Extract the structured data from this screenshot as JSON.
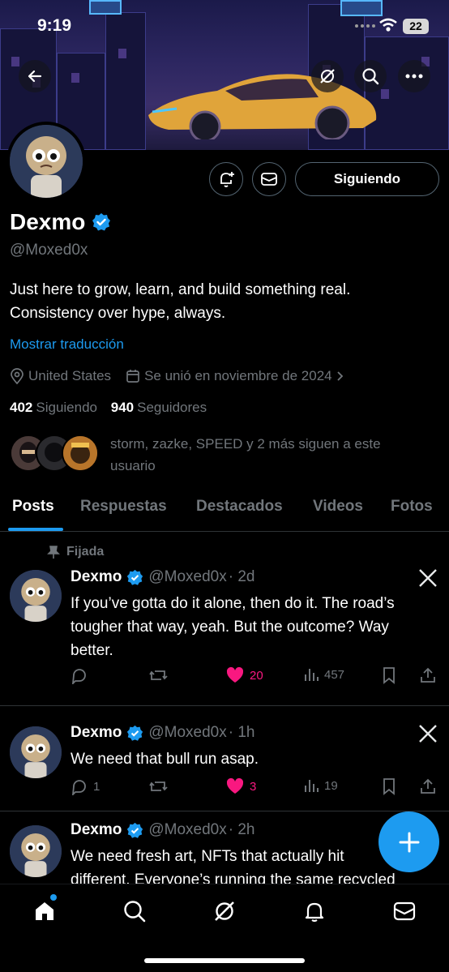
{
  "status_bar": {
    "time": "9:19",
    "battery": "22"
  },
  "profile": {
    "name": "Dexmo",
    "handle": "@Moxed0x",
    "bio_line1": "Just here to grow, learn, and build something real.",
    "bio_line2": "Consistency over hype, always.",
    "translate_label": "Mostrar traducción",
    "location": "United States",
    "joined": "Se unió en noviembre de 2024",
    "following_count": "402",
    "following_label": "Siguiendo",
    "followers_count": "940",
    "followers_label": "Seguidores",
    "followed_by_line1": "storm, zazke, SPEED y 2 más siguen a este",
    "followed_by_line2": "usuario",
    "following_button": "Siguiendo"
  },
  "tabs": [
    {
      "label": "Posts",
      "active": true
    },
    {
      "label": "Respuestas"
    },
    {
      "label": "Destacados"
    },
    {
      "label": "Videos"
    },
    {
      "label": "Fotos"
    }
  ],
  "pinned_label": "Fijada",
  "posts": [
    {
      "name": "Dexmo",
      "handle": "@Moxed0x",
      "time": "· 2d",
      "text_lines": [
        "If you’ve gotta do it alone, then do it. The road’s",
        "tougher that way, yeah. But the outcome? Way",
        "better."
      ],
      "replies": "",
      "reposts": "",
      "likes": "20",
      "views": "457"
    },
    {
      "name": "Dexmo",
      "handle": "@Moxed0x",
      "time": "· 1h",
      "text_lines": [
        "We need that bull run asap."
      ],
      "replies": "1",
      "reposts": "",
      "likes": "3",
      "views": "19"
    },
    {
      "name": "Dexmo",
      "handle": "@Moxed0x",
      "time": "· 2h",
      "text_lines": [
        "We need fresh art, NFTs that actually hit",
        "different. Everyone’s running the same recycled"
      ]
    }
  ],
  "colors": {
    "accent": "#1d9bf0",
    "like": "#f91880",
    "muted": "#71767b"
  }
}
